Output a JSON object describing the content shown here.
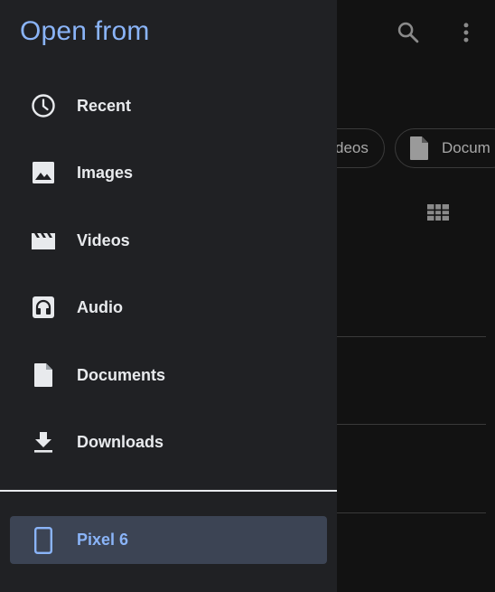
{
  "drawer": {
    "title": "Open from",
    "items": [
      {
        "label": "Recent",
        "icon": "clock-icon"
      },
      {
        "label": "Images",
        "icon": "image-icon"
      },
      {
        "label": "Videos",
        "icon": "movie-icon"
      },
      {
        "label": "Audio",
        "icon": "headphones-icon"
      },
      {
        "label": "Documents",
        "icon": "document-icon"
      },
      {
        "label": "Downloads",
        "icon": "download-icon"
      }
    ],
    "device": {
      "label": "Pixel 6",
      "icon": "phone-icon",
      "selected": true
    }
  },
  "background": {
    "chips": [
      {
        "label": "deos",
        "icon": null
      },
      {
        "label": "Docum",
        "icon": "document-icon"
      }
    ],
    "toolbar_icons": [
      "search-icon",
      "more-vert-icon"
    ],
    "view_toggle_icon": "grid-view-icon"
  },
  "colors": {
    "accent": "#8ab4f8",
    "drawer_bg": "#202124",
    "selected_bg": "#3c4454",
    "text": "#e8eaed"
  }
}
